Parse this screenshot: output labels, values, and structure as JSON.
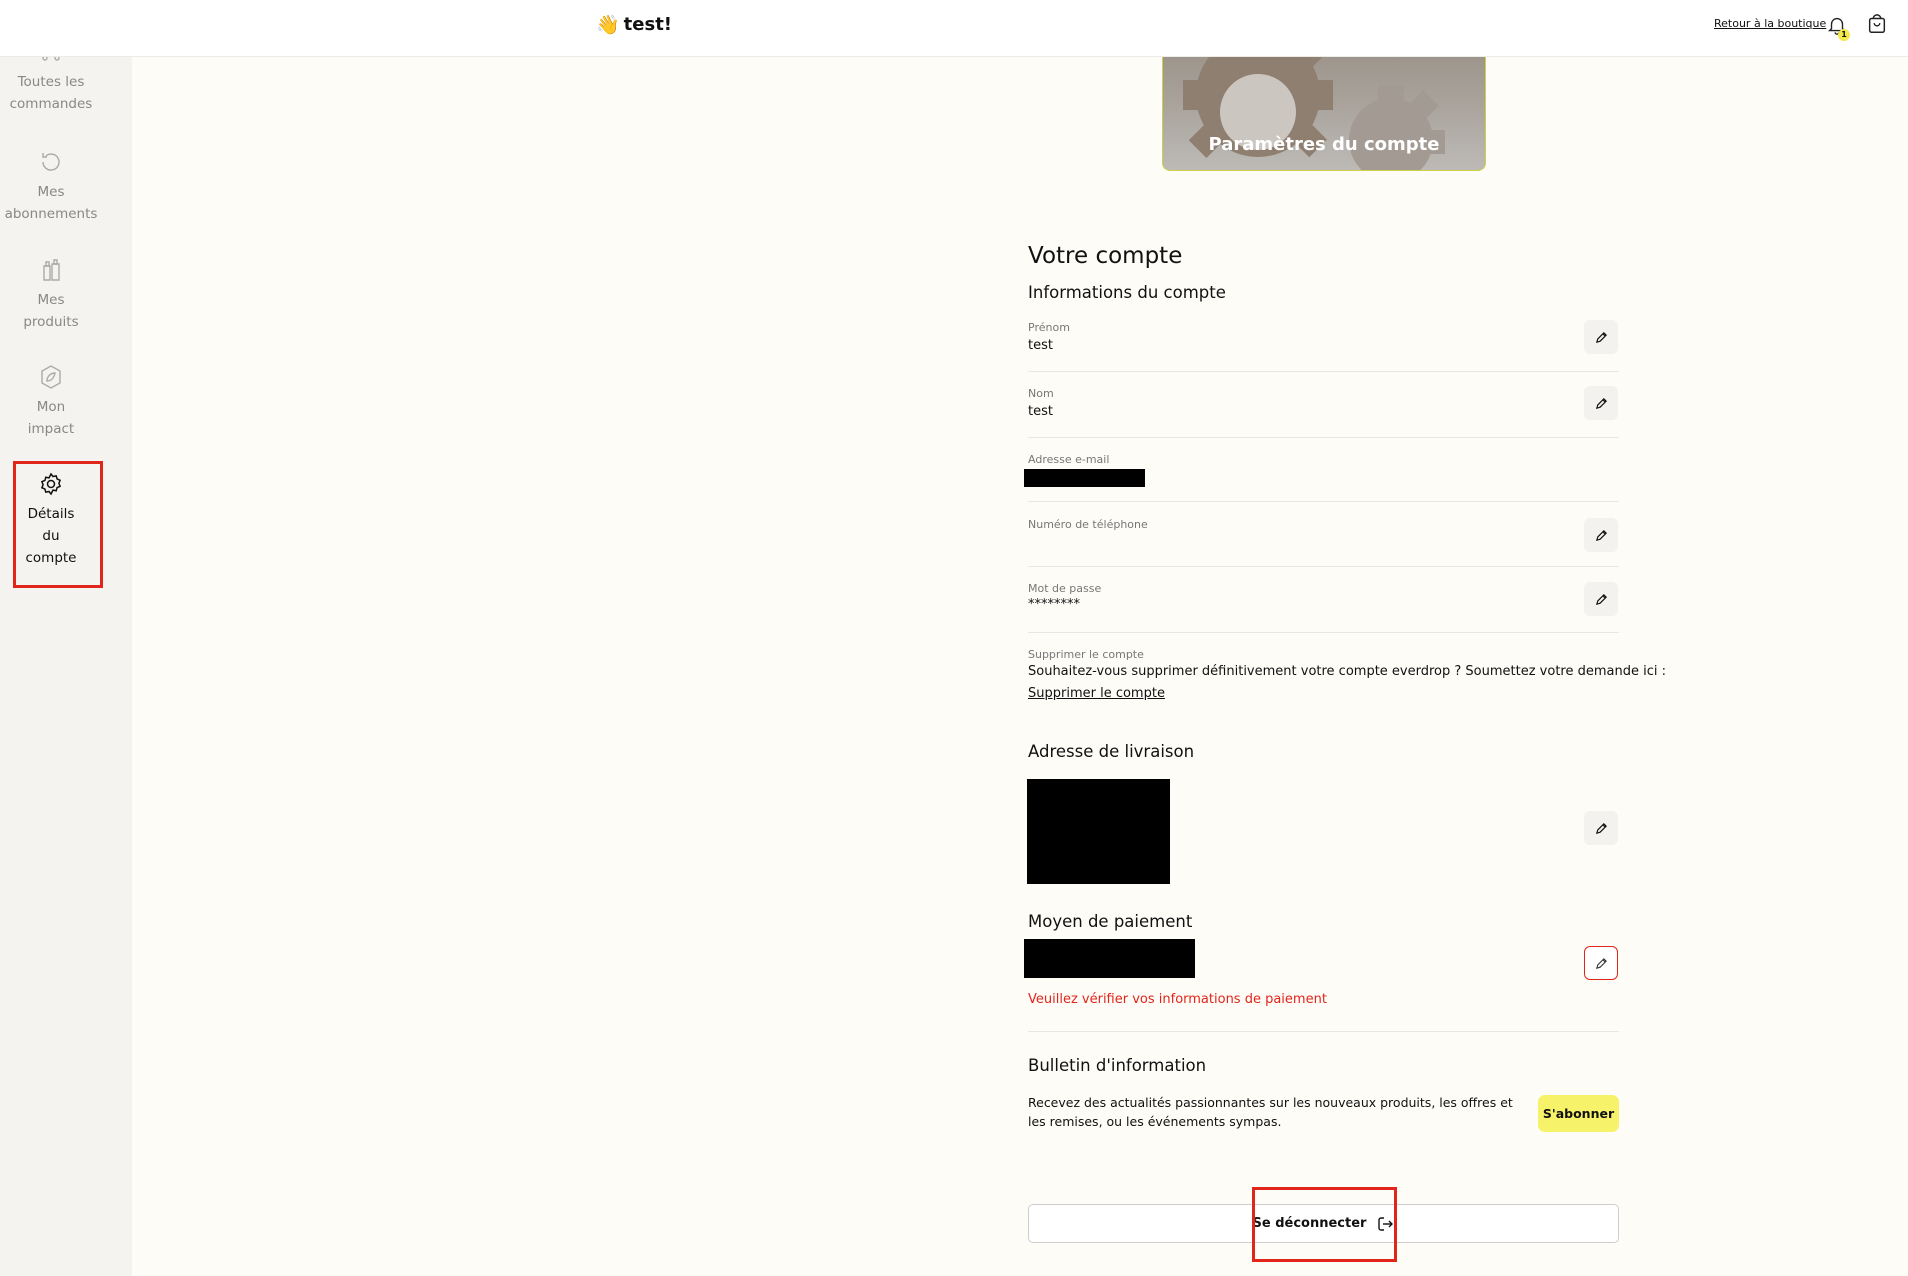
{
  "header": {
    "greeting_emoji": "👋",
    "greeting": "test!",
    "back_link": "Retour à la boutique",
    "notification_count": "1"
  },
  "sidebar": {
    "items": [
      {
        "label_line1": "Toutes les",
        "label_line2": "commandes",
        "icon": "truck-icon"
      },
      {
        "label_line1": "Mes",
        "label_line2": "abonnements",
        "icon": "refresh-icon"
      },
      {
        "label_line1": "Mes",
        "label_line2": "produits",
        "icon": "bottles-icon"
      },
      {
        "label_line1": "Mon",
        "label_line2": "impact",
        "icon": "leaf-icon"
      },
      {
        "label_line1": "Détails",
        "label_line2": "du",
        "label_line3": "compte",
        "icon": "gear-icon",
        "active": true
      }
    ]
  },
  "hero": {
    "title": "Paramètres du compte"
  },
  "account": {
    "title": "Votre compte",
    "info_title": "Informations du compte",
    "fields": {
      "first_name": {
        "label": "Prénom",
        "value": "test"
      },
      "last_name": {
        "label": "Nom",
        "value": "test"
      },
      "email": {
        "label": "Adresse e-mail",
        "value": ""
      },
      "phone": {
        "label": "Numéro de téléphone",
        "value": ""
      },
      "password": {
        "label": "Mot de passe",
        "value": "********"
      }
    },
    "delete": {
      "label": "Supprimer le compte",
      "text": "Souhaitez-vous supprimer définitivement votre compte everdrop ? Soumettez votre demande ici :",
      "link": "Supprimer le compte"
    }
  },
  "delivery": {
    "title": "Adresse de livraison"
  },
  "payment": {
    "title": "Moyen de paiement",
    "error": "Veuillez vérifier vos informations de paiement"
  },
  "newsletter": {
    "title": "Bulletin d'information",
    "text": "Recevez des actualités passionnantes sur les nouveaux produits, les offres et les remises, ou les événements sympas.",
    "subscribe": "S'abonner"
  },
  "logout": {
    "label": "Se déconnecter"
  },
  "colors": {
    "accent_yellow": "#f6f26a",
    "error_red": "#e1251b",
    "sidebar_bg": "#f4f3ef",
    "page_bg": "#fdfcf7"
  }
}
